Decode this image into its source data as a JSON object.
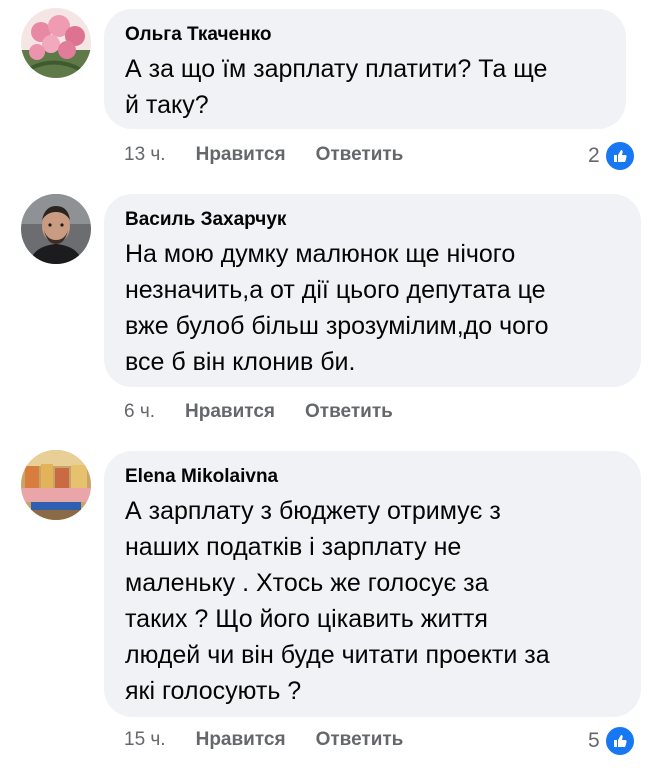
{
  "comments": [
    {
      "author": "Ольга Ткаченко",
      "text": "А за що їм зарплату платити? Та ще\nй таку?",
      "time": "13 ч.",
      "like_label": "Нравится",
      "reply_label": "Ответить",
      "reaction_count": "2"
    },
    {
      "author": "Василь Захарчук",
      "text": "На мою думку малюнок ще нічого\nнезначить,а от дії цього депутата це\nвже булоб більш зрозумілим,до чого\nвсе б він клонив би.",
      "time": "6 ч.",
      "like_label": "Нравится",
      "reply_label": "Ответить"
    },
    {
      "author": "Elena Mikolaivna",
      "text": "А зарплату з бюджету отримує з\nнаших податків і зарплату не\nмаленьку . Хтось же голосує за\nтаких ? Що його цікавить життя\nлюдей чи він буде читати проекти за\nякі  голосують ?",
      "time": "15 ч.",
      "like_label": "Нравится",
      "reply_label": "Ответить",
      "reaction_count": "5"
    }
  ],
  "icons": {
    "reaction": "like-thumbs-up-icon"
  },
  "colors": {
    "bubble": "#f0f2f5",
    "like": "#1877f2",
    "meta": "#65676b"
  }
}
